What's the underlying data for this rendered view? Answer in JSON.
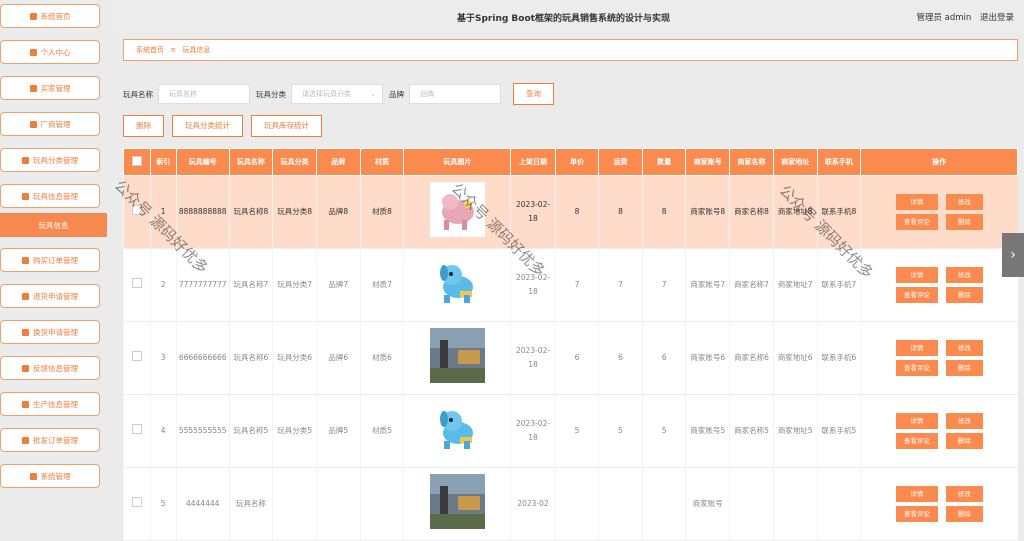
{
  "sidebar": {
    "items": [
      {
        "label": "系统首页",
        "icon": "home-icon"
      },
      {
        "label": "个人中心",
        "icon": "user-icon"
      },
      {
        "label": "买家管理",
        "icon": "grid-icon"
      },
      {
        "label": "厂商管理",
        "icon": "factory-icon"
      },
      {
        "label": "玩具分类管理",
        "icon": "chart-icon"
      },
      {
        "label": "玩具信息管理",
        "icon": "chart-icon"
      },
      {
        "label": "玩具信息",
        "icon": ""
      },
      {
        "label": "购买订单管理",
        "icon": "grid-icon"
      },
      {
        "label": "退货申请管理",
        "icon": "check-icon"
      },
      {
        "label": "换货申请管理",
        "icon": "grid-icon"
      },
      {
        "label": "反馈信息管理",
        "icon": "clipboard-icon"
      },
      {
        "label": "生产信息管理",
        "icon": "grid-icon"
      },
      {
        "label": "批发订单管理",
        "icon": "grid-icon"
      },
      {
        "label": "系统管理",
        "icon": "grid-icon"
      }
    ]
  },
  "header": {
    "title": "基于Spring Boot框架的玩具销售系统的设计与实现",
    "user": "管理员 admin",
    "logout": "退出登录"
  },
  "breadcrumb": {
    "home": "系统首页",
    "sep": "≡",
    "current": "玩具信息"
  },
  "filters": {
    "name_label": "玩具名称",
    "name_placeholder": "玩具名称",
    "category_label": "玩具分类",
    "category_placeholder": "请选择玩具分类",
    "brand_label": "品牌",
    "brand_placeholder": "品牌",
    "search_btn": "查询"
  },
  "actions": {
    "delete": "删除",
    "category_stats": "玩具分类统计",
    "stock_stats": "玩具库存统计"
  },
  "table": {
    "headers": [
      "索引",
      "玩具编号",
      "玩具名称",
      "玩具分类",
      "品牌",
      "材质",
      "玩具图片",
      "上架日期",
      "单价",
      "运费",
      "数量",
      "商家账号",
      "商家名称",
      "商家地址",
      "联系手机",
      "操作"
    ],
    "rows": [
      {
        "idx": "1",
        "code": "8888888888",
        "name": "玩具名称8",
        "cat": "玩具分类8",
        "brand": "品牌8",
        "mat": "材质8",
        "date": "2023-02-18",
        "price": "8",
        "ship": "8",
        "qty": "8",
        "acct": "商家账号8",
        "sname": "商家名称8",
        "addr": "商家地址8",
        "phone": "联系手机8",
        "img": "pink-toy"
      },
      {
        "idx": "2",
        "code": "7777777777",
        "name": "玩具名称7",
        "cat": "玩具分类7",
        "brand": "品牌7",
        "mat": "材质7",
        "date": "2023-02-18",
        "price": "7",
        "ship": "7",
        "qty": "7",
        "acct": "商家账号7",
        "sname": "商家名称7",
        "addr": "商家地址7",
        "phone": "联系手机7",
        "img": "blue-dog"
      },
      {
        "idx": "3",
        "code": "6666666666",
        "name": "玩具名称6",
        "cat": "玩具分类6",
        "brand": "品牌6",
        "mat": "材质6",
        "date": "2023-02-18",
        "price": "6",
        "ship": "6",
        "qty": "6",
        "acct": "商家账号6",
        "sname": "商家名称6",
        "addr": "商家地址6",
        "phone": "联系手机6",
        "img": "photo"
      },
      {
        "idx": "4",
        "code": "5555555555",
        "name": "玩具名称5",
        "cat": "玩具分类5",
        "brand": "品牌5",
        "mat": "材质5",
        "date": "2023-02-18",
        "price": "5",
        "ship": "5",
        "qty": "5",
        "acct": "商家账号5",
        "sname": "商家名称5",
        "addr": "商家地址5",
        "phone": "联系手机5",
        "img": "blue-dog"
      },
      {
        "idx": "5",
        "code": "4444444",
        "name": "玩具名称",
        "cat": "",
        "brand": "",
        "mat": "",
        "date": "2023-02",
        "price": "",
        "ship": "",
        "qty": "",
        "acct": "商家账号",
        "sname": "",
        "addr": "",
        "phone": "",
        "img": "photo"
      }
    ],
    "ops": {
      "detail": "详情",
      "edit": "修改",
      "review": "查看评论",
      "delete": "删除"
    }
  },
  "watermark": {
    "text1": "公众号 源码好优多",
    "text2": "公众号 源码好优多",
    "text3": "公众号 源码好优多"
  },
  "colors": {
    "accent": "#fb8a4e",
    "highlight": "#ffdcc9"
  }
}
